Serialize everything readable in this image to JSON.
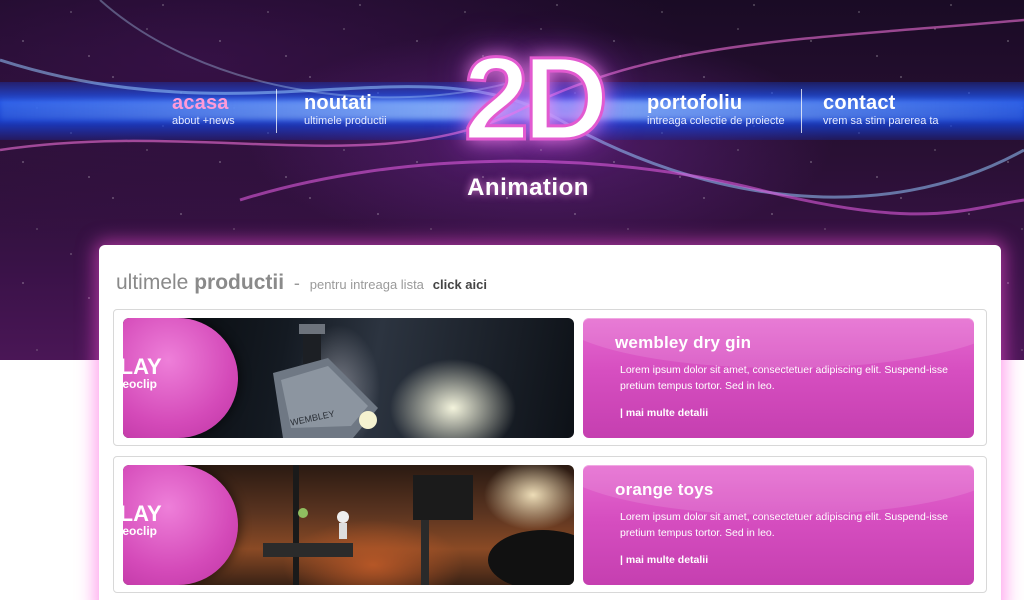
{
  "nav": [
    {
      "label": "acasa",
      "sub": "about +news"
    },
    {
      "label": "noutati",
      "sub": "ultimele productii"
    },
    {
      "label": "portofoliu",
      "sub": "intreaga colectie de proiecte"
    },
    {
      "label": "contact",
      "sub": "vrem sa stim parerea ta"
    }
  ],
  "logo": {
    "main": "2D",
    "sub": "Animation"
  },
  "section": {
    "title_light": "ultimele",
    "title_bold": "productii",
    "dash": "-",
    "note": "pentru intreaga lista",
    "link": "click aici"
  },
  "products": [
    {
      "play": "PLAY",
      "play_sub": "videoclip",
      "title": "wembley dry gin",
      "text": "Lorem ipsum dolor sit amet, consectetuer adipiscing elit. Suspend-isse pretium tempus tortor. Sed in leo.",
      "link": "| mai multe detalii"
    },
    {
      "play": "PLAY",
      "play_sub": "videoclip",
      "title": "orange toys",
      "text": "Lorem ipsum dolor sit amet, consectetuer adipiscing elit. Suspend-isse pretium tempus tortor. Sed in leo.",
      "link": "| mai multe detalii"
    }
  ],
  "colors": {
    "accent": "#d64ec0",
    "nav_active": "#ff9ad8",
    "band": "#1e5aff"
  },
  "icons": {
    "play": "play-arrow-icon"
  }
}
